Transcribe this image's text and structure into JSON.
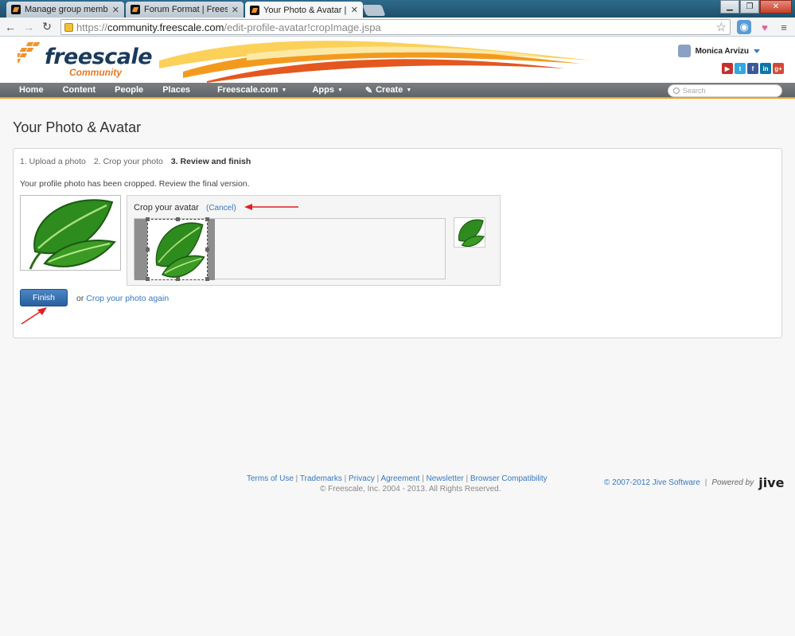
{
  "browser": {
    "tabs": [
      {
        "title": "Manage group members |"
      },
      {
        "title": "Forum Format | Freescale"
      },
      {
        "title": "Your Photo & Avatar | Fre"
      }
    ],
    "url_proto": "https://",
    "url_host": "community.freescale.com",
    "url_path": "/edit-profile-avatar!cropImage.jspa"
  },
  "header": {
    "logo_text": "freescale",
    "logo_sub": "Community",
    "user_name": "Monica Arvizu"
  },
  "nav": {
    "items": [
      {
        "label": "Home"
      },
      {
        "label": "Content"
      },
      {
        "label": "People"
      },
      {
        "label": "Places"
      },
      {
        "label": "Freescale.com"
      },
      {
        "label": "Apps"
      },
      {
        "label": "Create"
      }
    ],
    "search_placeholder": "Search"
  },
  "page": {
    "title": "Your Photo & Avatar",
    "steps": [
      {
        "label": "1. Upload a photo"
      },
      {
        "label": "2. Crop your photo"
      },
      {
        "label": "3. Review and finish"
      }
    ],
    "message": "Your profile photo has been cropped. Review the final version.",
    "crop_label": "Crop your avatar",
    "crop_cancel": "(Cancel)",
    "finish_label": "Finish",
    "or_text": "or",
    "crop_again": "Crop your photo again"
  },
  "footer": {
    "links": [
      {
        "label": "Terms of Use"
      },
      {
        "label": "Trademarks"
      },
      {
        "label": "Privacy"
      },
      {
        "label": "Agreement"
      },
      {
        "label": "Newsletter"
      },
      {
        "label": "Browser Compatibility"
      }
    ],
    "copyright": "© Freescale, Inc. 2004 - 2013. All Rights Reserved.",
    "jive_copyright": "© 2007-2012 Jive Software",
    "powered_by": "Powered by",
    "jive_logo": "jive"
  },
  "colors": {
    "nav_bg": "#6b6f72",
    "accent": "#f0a21c",
    "link": "#3778c0",
    "button": "#2a5f9e"
  }
}
